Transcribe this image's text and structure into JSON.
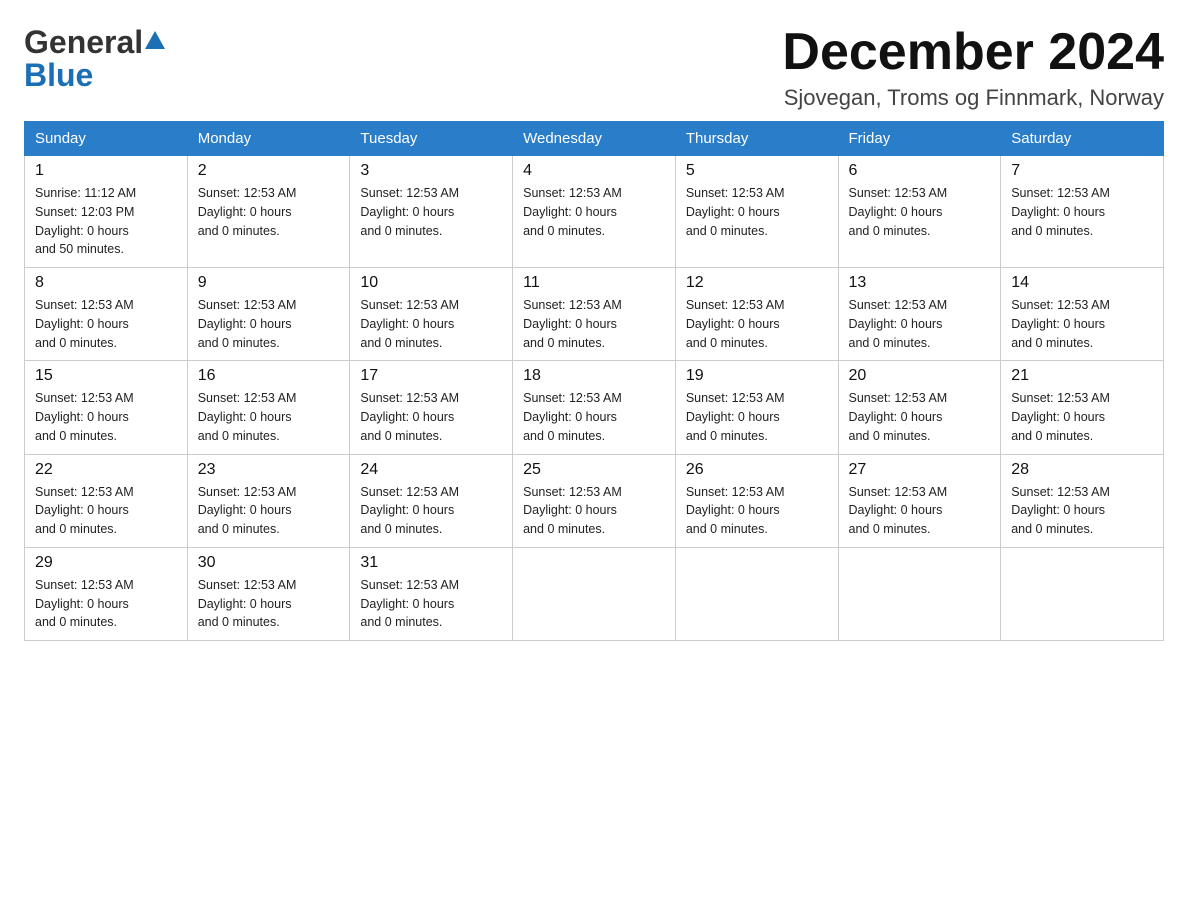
{
  "header": {
    "logo_text_general": "General",
    "logo_text_blue": "Blue",
    "title": "December 2024",
    "location": "Sjovegan, Troms og Finnmark, Norway"
  },
  "calendar": {
    "days_of_week": [
      "Sunday",
      "Monday",
      "Tuesday",
      "Wednesday",
      "Thursday",
      "Friday",
      "Saturday"
    ],
    "weeks": [
      [
        {
          "day": "1",
          "info": "Sunrise: 11:12 AM\nSunset: 12:03 PM\nDaylight: 0 hours\nand 50 minutes."
        },
        {
          "day": "2",
          "info": "Sunset: 12:53 AM\nDaylight: 0 hours\nand 0 minutes."
        },
        {
          "day": "3",
          "info": "Sunset: 12:53 AM\nDaylight: 0 hours\nand 0 minutes."
        },
        {
          "day": "4",
          "info": "Sunset: 12:53 AM\nDaylight: 0 hours\nand 0 minutes."
        },
        {
          "day": "5",
          "info": "Sunset: 12:53 AM\nDaylight: 0 hours\nand 0 minutes."
        },
        {
          "day": "6",
          "info": "Sunset: 12:53 AM\nDaylight: 0 hours\nand 0 minutes."
        },
        {
          "day": "7",
          "info": "Sunset: 12:53 AM\nDaylight: 0 hours\nand 0 minutes."
        }
      ],
      [
        {
          "day": "8",
          "info": "Sunset: 12:53 AM\nDaylight: 0 hours\nand 0 minutes."
        },
        {
          "day": "9",
          "info": "Sunset: 12:53 AM\nDaylight: 0 hours\nand 0 minutes."
        },
        {
          "day": "10",
          "info": "Sunset: 12:53 AM\nDaylight: 0 hours\nand 0 minutes."
        },
        {
          "day": "11",
          "info": "Sunset: 12:53 AM\nDaylight: 0 hours\nand 0 minutes."
        },
        {
          "day": "12",
          "info": "Sunset: 12:53 AM\nDaylight: 0 hours\nand 0 minutes."
        },
        {
          "day": "13",
          "info": "Sunset: 12:53 AM\nDaylight: 0 hours\nand 0 minutes."
        },
        {
          "day": "14",
          "info": "Sunset: 12:53 AM\nDaylight: 0 hours\nand 0 minutes."
        }
      ],
      [
        {
          "day": "15",
          "info": "Sunset: 12:53 AM\nDaylight: 0 hours\nand 0 minutes."
        },
        {
          "day": "16",
          "info": "Sunset: 12:53 AM\nDaylight: 0 hours\nand 0 minutes."
        },
        {
          "day": "17",
          "info": "Sunset: 12:53 AM\nDaylight: 0 hours\nand 0 minutes."
        },
        {
          "day": "18",
          "info": "Sunset: 12:53 AM\nDaylight: 0 hours\nand 0 minutes."
        },
        {
          "day": "19",
          "info": "Sunset: 12:53 AM\nDaylight: 0 hours\nand 0 minutes."
        },
        {
          "day": "20",
          "info": "Sunset: 12:53 AM\nDaylight: 0 hours\nand 0 minutes."
        },
        {
          "day": "21",
          "info": "Sunset: 12:53 AM\nDaylight: 0 hours\nand 0 minutes."
        }
      ],
      [
        {
          "day": "22",
          "info": "Sunset: 12:53 AM\nDaylight: 0 hours\nand 0 minutes."
        },
        {
          "day": "23",
          "info": "Sunset: 12:53 AM\nDaylight: 0 hours\nand 0 minutes."
        },
        {
          "day": "24",
          "info": "Sunset: 12:53 AM\nDaylight: 0 hours\nand 0 minutes."
        },
        {
          "day": "25",
          "info": "Sunset: 12:53 AM\nDaylight: 0 hours\nand 0 minutes."
        },
        {
          "day": "26",
          "info": "Sunset: 12:53 AM\nDaylight: 0 hours\nand 0 minutes."
        },
        {
          "day": "27",
          "info": "Sunset: 12:53 AM\nDaylight: 0 hours\nand 0 minutes."
        },
        {
          "day": "28",
          "info": "Sunset: 12:53 AM\nDaylight: 0 hours\nand 0 minutes."
        }
      ],
      [
        {
          "day": "29",
          "info": "Sunset: 12:53 AM\nDaylight: 0 hours\nand 0 minutes."
        },
        {
          "day": "30",
          "info": "Sunset: 12:53 AM\nDaylight: 0 hours\nand 0 minutes."
        },
        {
          "day": "31",
          "info": "Sunset: 12:53 AM\nDaylight: 0 hours\nand 0 minutes."
        },
        {
          "day": "",
          "info": ""
        },
        {
          "day": "",
          "info": ""
        },
        {
          "day": "",
          "info": ""
        },
        {
          "day": "",
          "info": ""
        }
      ]
    ]
  }
}
